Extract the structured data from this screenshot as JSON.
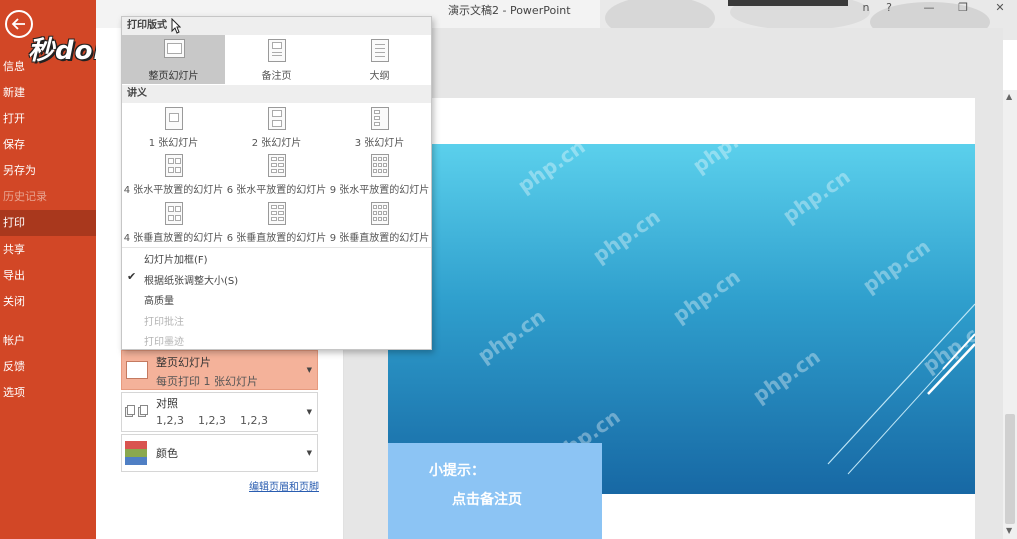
{
  "titlebar": {
    "title": "演示文稿2 - PowerPoint",
    "help": "?",
    "minimize": "—",
    "restore": "❐",
    "close": "✕",
    "user_partial": "n"
  },
  "sidebar": {
    "items": [
      {
        "label": "信息"
      },
      {
        "label": "新建"
      },
      {
        "label": "打开"
      },
      {
        "label": "保存"
      },
      {
        "label": "另存为"
      },
      {
        "label": "历史记录"
      },
      {
        "label": "打印"
      },
      {
        "label": "共享"
      },
      {
        "label": "导出"
      },
      {
        "label": "关闭"
      },
      {
        "label": "帐户"
      },
      {
        "label": "反馈"
      },
      {
        "label": "选项"
      }
    ],
    "watermark": "秒dong视频"
  },
  "popup": {
    "layout_header": "打印版式",
    "layout_options": [
      {
        "label": "整页幻灯片"
      },
      {
        "label": "备注页"
      },
      {
        "label": "大纲"
      }
    ],
    "handouts_header": "讲义",
    "handout_options": [
      {
        "label": "1 张幻灯片"
      },
      {
        "label": "2 张幻灯片"
      },
      {
        "label": "3 张幻灯片"
      },
      {
        "label": "4 张水平放置的幻灯片"
      },
      {
        "label": "6 张水平放置的幻灯片"
      },
      {
        "label": "9 张水平放置的幻灯片"
      },
      {
        "label": "4 张垂直放置的幻灯片"
      },
      {
        "label": "6 张垂直放置的幻灯片"
      },
      {
        "label": "9 张垂直放置的幻灯片"
      }
    ],
    "menu_items": [
      {
        "label": "幻灯片加框(F)"
      },
      {
        "label": "根据纸张调整大小(S)"
      },
      {
        "label": "高质量"
      },
      {
        "label": "打印批注"
      },
      {
        "label": "打印墨迹"
      }
    ]
  },
  "settings": {
    "layout_main": "整页幻灯片",
    "layout_sub": "每页打印 1 张幻灯片",
    "collate_main": "对照",
    "collate_sub": "1,2,3    1,2,3    1,2,3",
    "color_main": "颜色",
    "edit_header_footer": "编辑页眉和页脚"
  },
  "preview": {
    "tip_line1": "小提示：",
    "tip_line2": "点击备注页",
    "watermark_text": "php.cn"
  },
  "colors": {
    "sidebar": "#d24726",
    "sidebar_active": "#a9381d",
    "layout_box": "#f4b29a",
    "tip_box": "#8cc4f4"
  }
}
